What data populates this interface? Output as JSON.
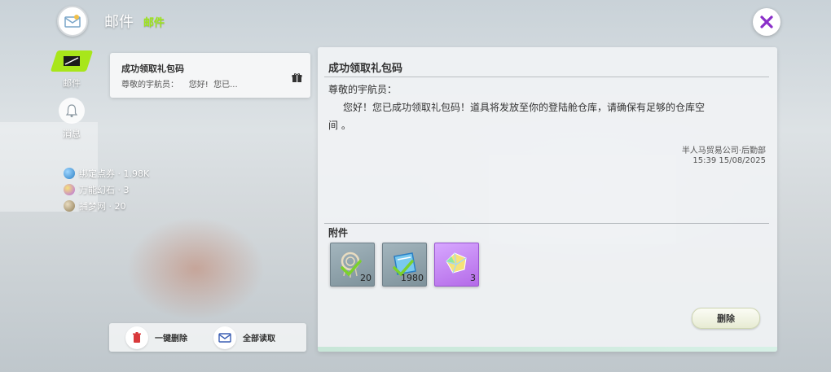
{
  "header": {
    "title": "邮件",
    "subtitle": "邮件"
  },
  "sidebar": {
    "items": [
      {
        "label": "邮件",
        "icon": "mail-icon",
        "active": true
      },
      {
        "label": "消息",
        "icon": "bell-icon",
        "active": false
      }
    ]
  },
  "currencies": [
    {
      "label": "绑定点券 · 1.98K",
      "icon": "coupon-icon",
      "color": "#4ea3e0"
    },
    {
      "label": "万能幻石 · 3",
      "icon": "gem-icon",
      "color": "#c38be8"
    },
    {
      "label": "捕梦网 · 20",
      "icon": "dreamcatcher-icon",
      "color": "#b7a27a"
    }
  ],
  "mail_list": [
    {
      "title": "成功领取礼包码",
      "preview": "尊敬的宇航员：    您好!  您已...",
      "icon": "gift-icon"
    }
  ],
  "actions": {
    "delete_all": "一键删除",
    "read_all": "全部读取"
  },
  "detail": {
    "title": "成功领取礼包码",
    "greeting": "尊敬的宇航员：",
    "body": "您好！您已成功领取礼包码！道具将发放至你的登陆舱仓库，请确保有足够的仓库空间 。",
    "sender": "半人马贸易公司·后勤部",
    "date": "15:39 15/08/2025",
    "attachments_label": "附件",
    "attachments": [
      {
        "icon": "dreamcatcher-icon",
        "count": "20",
        "rarity": "grey"
      },
      {
        "icon": "coupon-icon",
        "count": "1980",
        "rarity": "grey"
      },
      {
        "icon": "gem-icon",
        "count": "3",
        "rarity": "purple"
      }
    ],
    "delete_label": "删除"
  },
  "colors": {
    "accent_green": "#a8e61a",
    "subtitle_green": "#9ee51a",
    "rare_purple": "#b46be8",
    "close_x": "#8a2fc9"
  }
}
